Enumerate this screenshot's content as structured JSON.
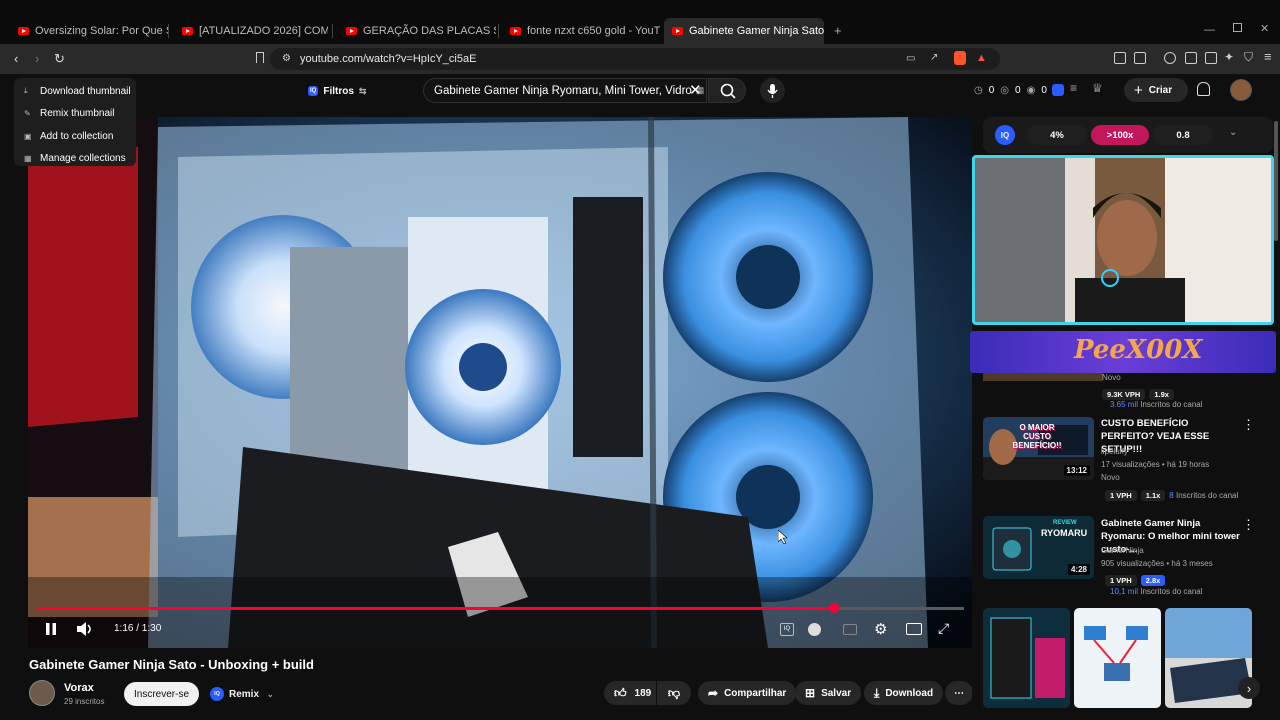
{
  "browser": {
    "tabs": [
      {
        "title": "Oversizing Solar: Por Que Seu Invers"
      },
      {
        "title": "[ATUALIZADO 2026] COMO GANHAR"
      },
      {
        "title": "GERAÇÃO DAS PLACAS SOLAR EM D"
      },
      {
        "title": "fonte nzxt c650 gold - YouTube"
      },
      {
        "title": "Gabinete Gamer Ninja Sato -"
      }
    ],
    "new_tab": "+",
    "url": "youtube.com/watch?v=HpIcY_ci5aE"
  },
  "thumb_menu": {
    "items": [
      {
        "label": "Download thumbnail"
      },
      {
        "label": "Remix thumbnail"
      },
      {
        "label": "Add to collection"
      },
      {
        "label": "Manage collections"
      }
    ]
  },
  "header": {
    "filters_label": "Filtros",
    "search_value": "Gabinete Gamer Ninja Ryomaru, Mini Tower, Vidro",
    "counts": [
      "0",
      "0",
      "0"
    ],
    "create_label": "Criar"
  },
  "player": {
    "time": "1:16 / 1:30",
    "progress": 0.86
  },
  "video": {
    "title": "Gabinete Gamer Ninja Sato - Unboxing + build",
    "channel": "Vorax",
    "subscribers": "29 inscritos",
    "subscribe_label": "Inscrever-se",
    "remix_label": "Remix",
    "likes": "189",
    "share_label": "Compartilhar",
    "save_label": "Salvar",
    "download_label": "Download"
  },
  "vidiq": {
    "stats": [
      "4%",
      ">100x",
      "0.8"
    ]
  },
  "overlay": {
    "banner_text": "PeeX00X"
  },
  "recs": [
    {
      "badge": "Novo",
      "vph": "9.3K VPH",
      "mult": "1.9x",
      "subs_value": "3.65 mil",
      "subs_label": "Inscritos do canal"
    },
    {
      "title": "CUSTO BENEFÍCIO PERFEITO? VEJA ESSE SETUP!!!",
      "channel": "lipeluffy",
      "meta": "17 visualizações  •  há 19 horas",
      "badge": "Novo",
      "duration": "13:12",
      "vph": "1 VPH",
      "mult": "1.1x",
      "subs_value": "8",
      "subs_label": "Inscritos do canal",
      "thumb_text": "O MAIOR CUSTO BENEFÍCIO!!"
    },
    {
      "title": "Gabinete Gamer Ninja Ryomaru: O melhor mini tower custo-...",
      "channel": "GamerNinja",
      "meta": "905 visualizações  •  há 3 meses",
      "duration": "4:28",
      "vph": "1 VPH",
      "mult": "2.8x",
      "subs_value": "10,1 mil",
      "subs_label": "Inscritos do canal",
      "thumb_text_1": "REVIEW",
      "thumb_text_2": "RYOMARU"
    }
  ],
  "colors": {
    "accent": "#ff0033",
    "vidiq": "#2b5cff",
    "bg": "#0f0f0f"
  }
}
